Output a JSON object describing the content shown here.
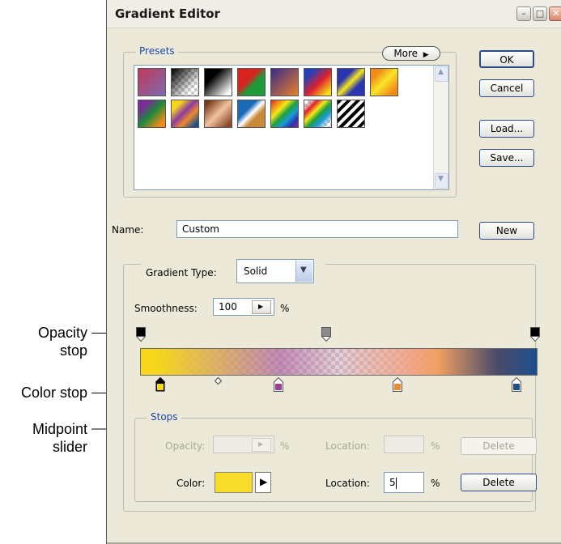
{
  "callouts": {
    "opacity_stop": [
      "Opacity",
      "stop"
    ],
    "color_stop": "Color stop",
    "midpoint_slider": [
      "Midpoint",
      "slider"
    ]
  },
  "dialog": {
    "title": "Gradient Editor",
    "window_buttons": [
      "minimize",
      "maximize",
      "close"
    ]
  },
  "presets": {
    "legend": "Presets",
    "more_label": "More",
    "swatch_icons": [
      "preset-foreground-to-background",
      "preset-transparent-checker",
      "preset-black-white",
      "preset-red-green",
      "preset-violet-orange",
      "preset-blue-red-yellow",
      "preset-blue-yellow-blue",
      "preset-orange-yellow-orange",
      "preset-violet-green-orange",
      "preset-yellow-violet-orange-blue",
      "preset-copper",
      "preset-chrome",
      "preset-spectrum",
      "preset-transparent-rainbow",
      "preset-transparent-stripes"
    ]
  },
  "buttons": {
    "ok": "OK",
    "cancel": "Cancel",
    "load": "Load...",
    "save": "Save...",
    "new": "New"
  },
  "name": {
    "label": "Name:",
    "value": "Custom"
  },
  "gradient_type": {
    "label": "Gradient Type:",
    "value": "Solid"
  },
  "smoothness": {
    "label": "Smoothness:",
    "value": "100",
    "unit": "%"
  },
  "gradient": {
    "colors": {
      "yellow": "#f6d71c",
      "violet": "#9a3f96",
      "orange": "#f0882e",
      "blue": "#1d4f8f"
    }
  },
  "stops": {
    "legend": "Stops",
    "opacity_label": "Opacity:",
    "opacity_unit": "%",
    "location_label_top": "Location:",
    "location_unit_top": "%",
    "delete_top": "Delete",
    "color_label": "Color:",
    "color_swatch": "#f7dc2a",
    "location_label_bottom": "Location:",
    "location_value": "5",
    "location_unit_bottom": "%",
    "delete_bottom": "Delete"
  }
}
